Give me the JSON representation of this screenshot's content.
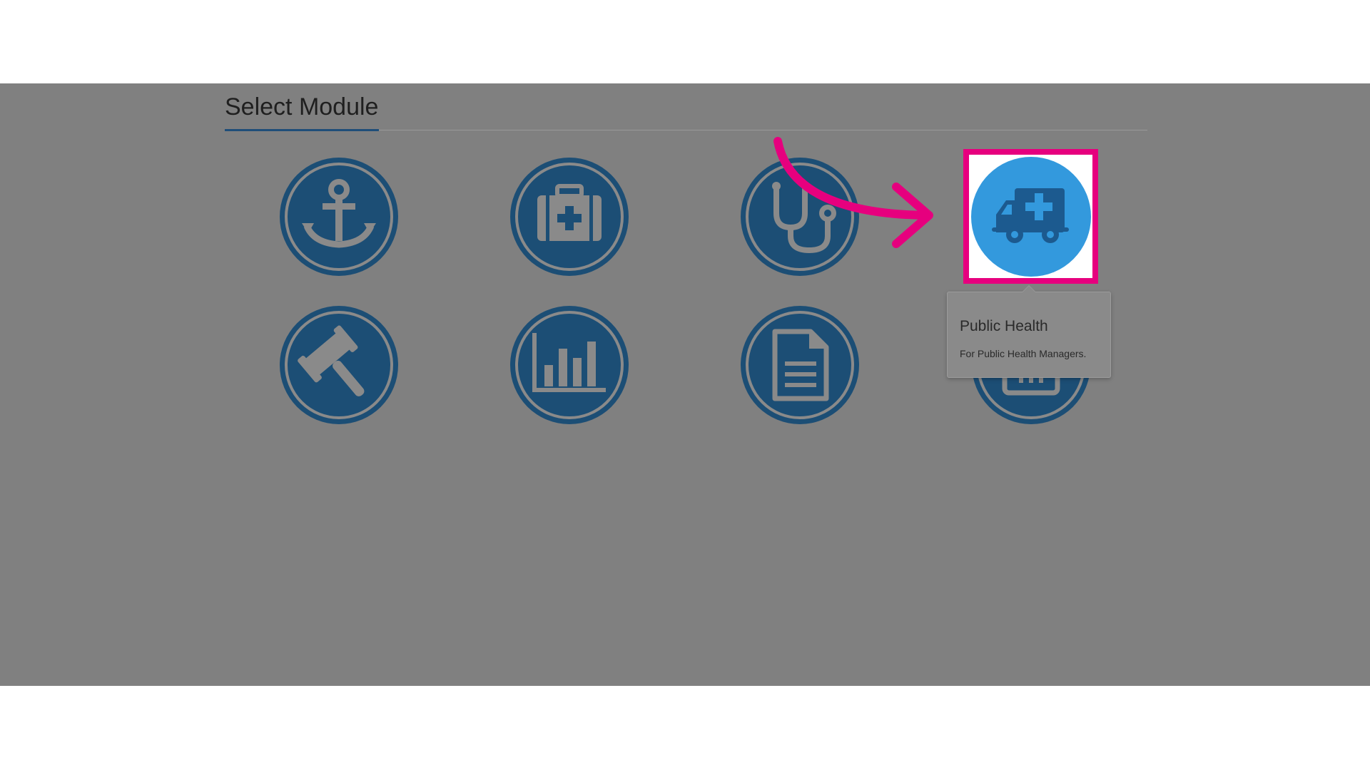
{
  "page": {
    "title": "Select Module"
  },
  "modules": [
    {
      "icon": "anchor-icon"
    },
    {
      "icon": "medical-kit-icon"
    },
    {
      "icon": "stethoscope-icon"
    },
    {
      "icon": "ambulance-icon",
      "highlighted": true
    },
    {
      "icon": "gavel-icon"
    },
    {
      "icon": "bar-chart-icon"
    },
    {
      "icon": "document-icon"
    },
    {
      "icon": "robot-icon"
    }
  ],
  "tooltip": {
    "title": "Public Health",
    "description": "For Public Health Managers."
  },
  "colors": {
    "overlay": "#808080",
    "module_dark": "#1c4e75",
    "module_icon": "#8a8a8a",
    "module_active": "#3399dd",
    "module_active_icon": "#1c5a8f",
    "highlight_border": "#e6007e",
    "arrow": "#e6007e"
  }
}
